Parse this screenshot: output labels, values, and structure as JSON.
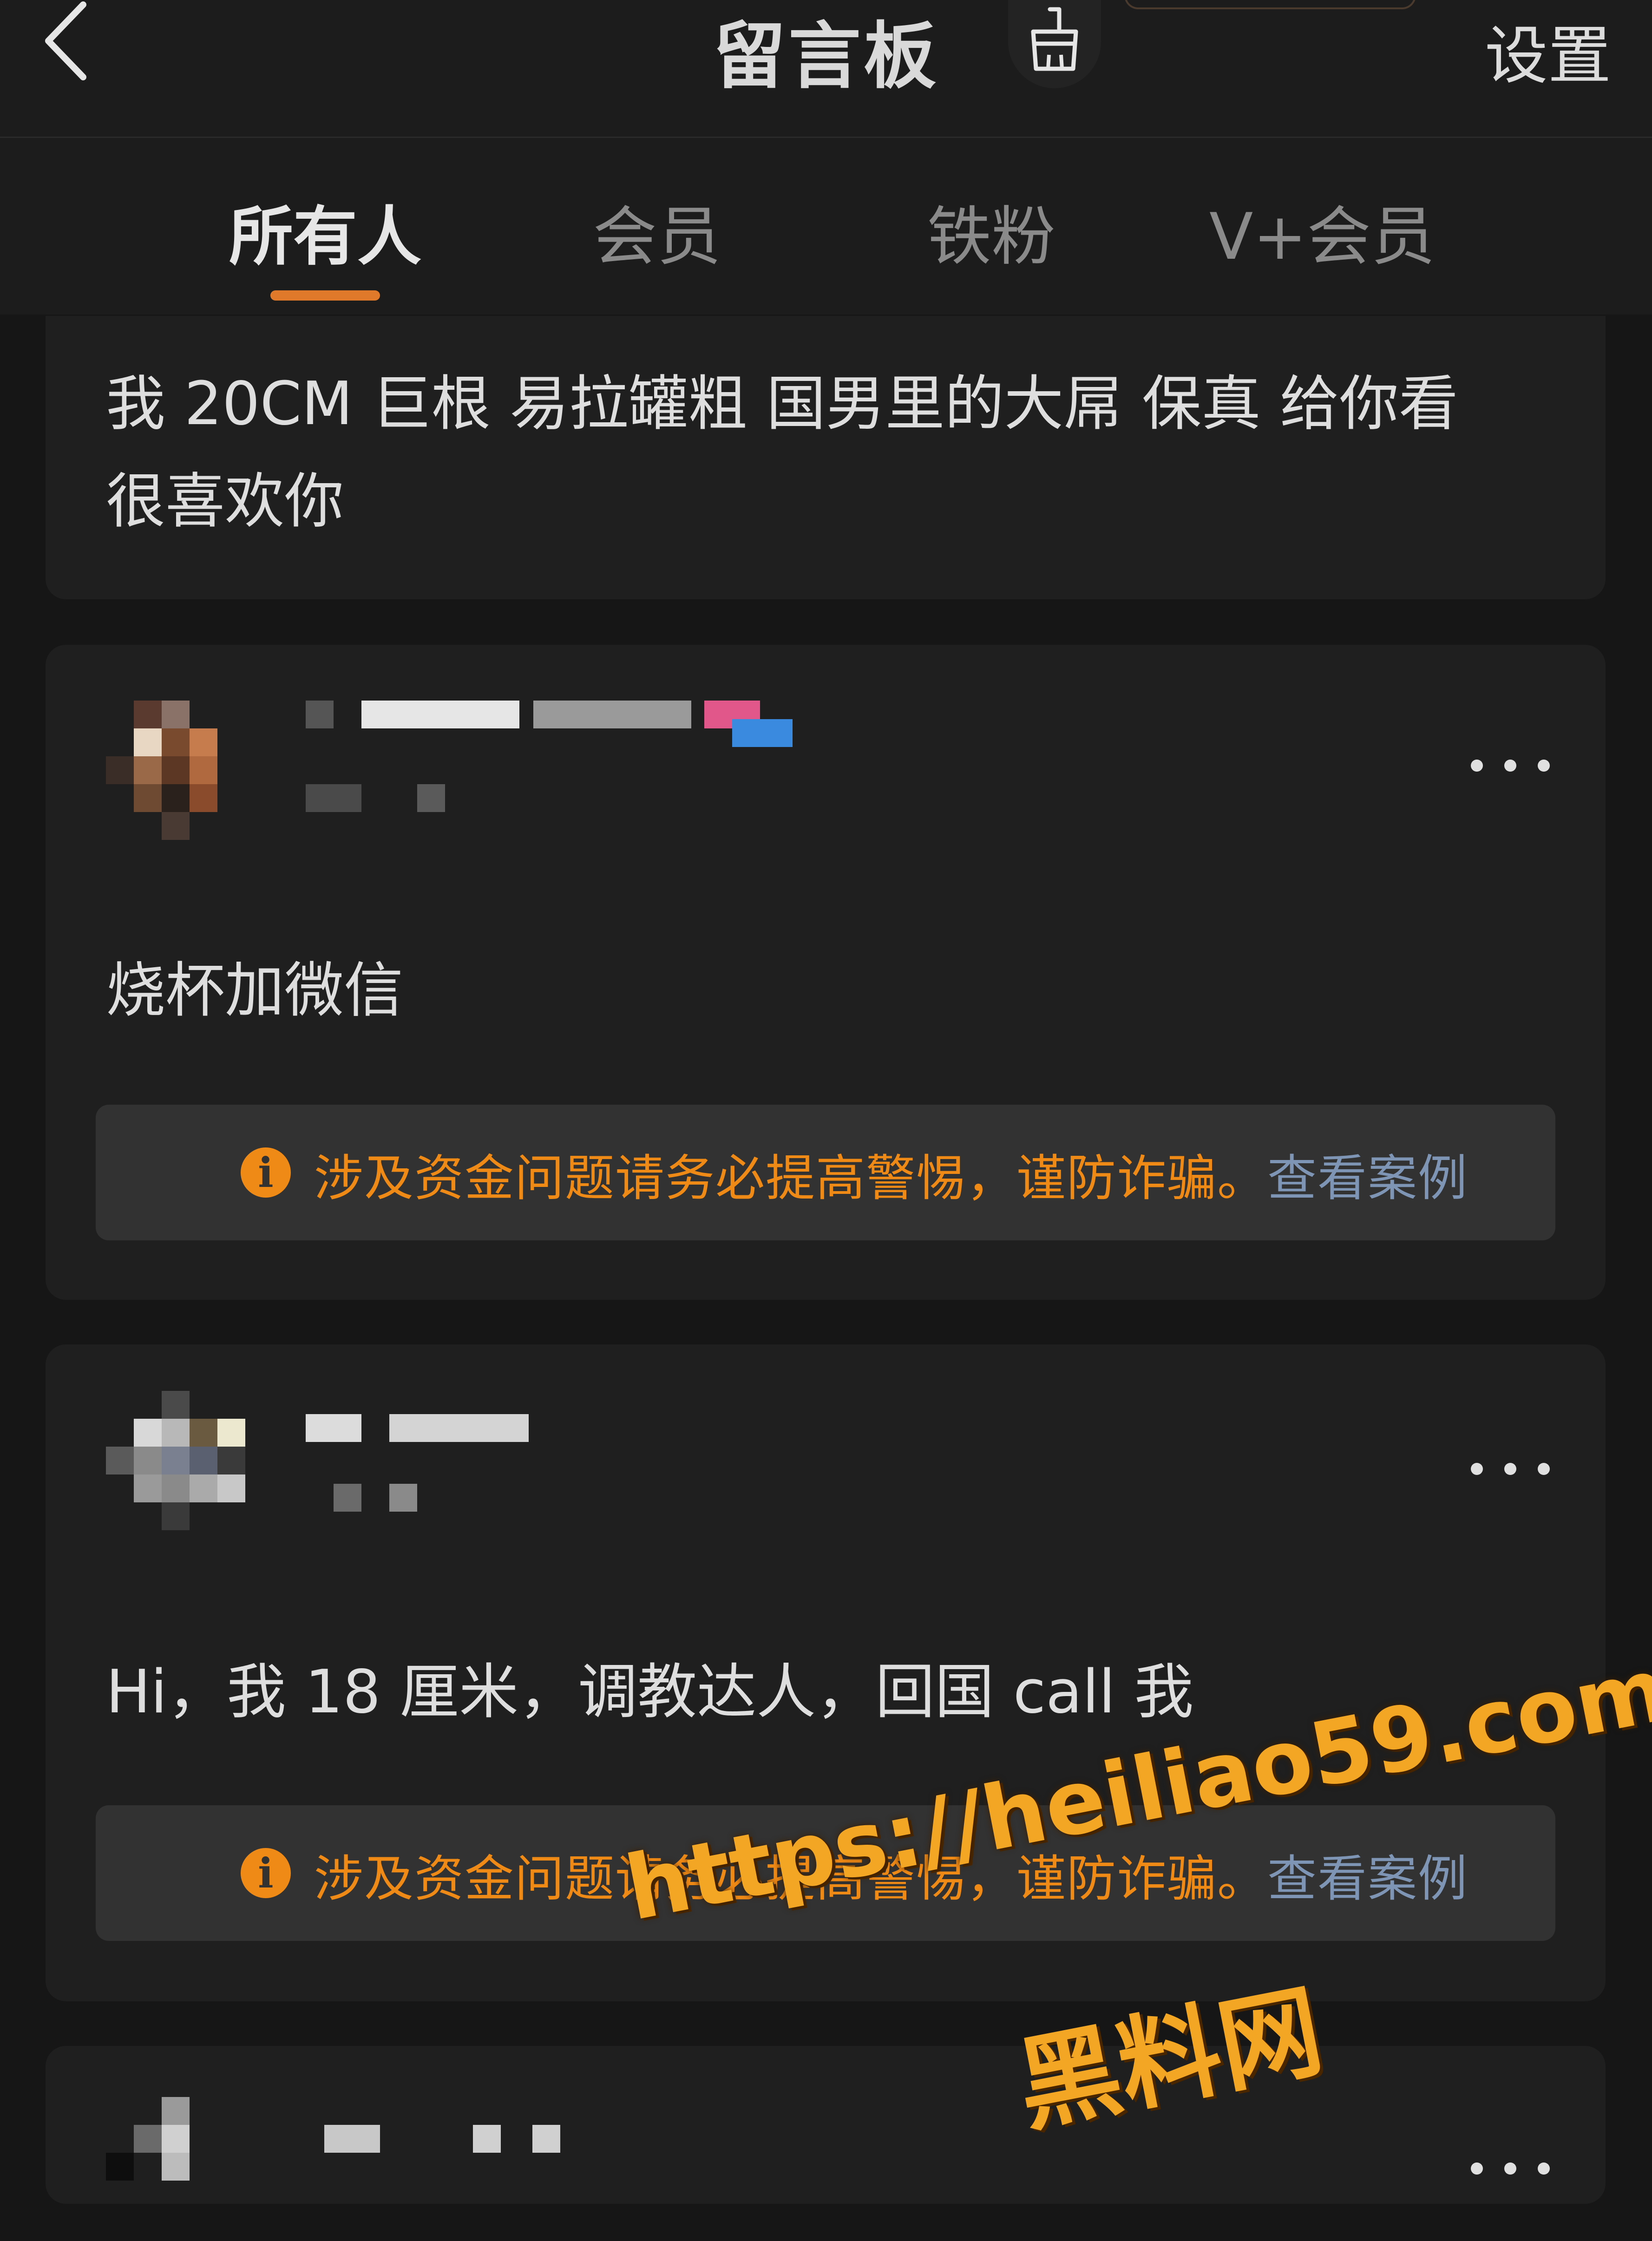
{
  "header": {
    "title": "留言板",
    "settings_label": "设置"
  },
  "tabs": [
    {
      "label": "所有人",
      "active": true
    },
    {
      "label": "会员",
      "active": false
    },
    {
      "label": "铁粉",
      "active": false
    },
    {
      "label": "V+会员",
      "active": false
    }
  ],
  "messages": [
    {
      "text": "我 20CM 巨根 易拉罐粗 国男里的大屌 保真 给你看\n很喜欢你"
    },
    {
      "text": "烧杯加微信",
      "warning": "涉及资金问题请务必提高警惕，谨防诈骗。",
      "warning_link": "查看案例"
    },
    {
      "text": "Hi，我 18 厘米，调教达人，回国 call 我",
      "warning": "涉及资金问题请务必提高警惕，谨防诈骗。",
      "warning_link": "查看案例"
    }
  ],
  "watermark": {
    "url": "https://heiliao59.com",
    "name": "黑料网"
  },
  "colors": {
    "background": "#161616",
    "card": "#1f1f1f",
    "accent": "#e07a2a",
    "warning": "#f08a16",
    "link": "#7f95b5"
  },
  "icons": [
    "back-chevron-icon",
    "brush-icon",
    "more-dots-icon",
    "info-icon"
  ]
}
